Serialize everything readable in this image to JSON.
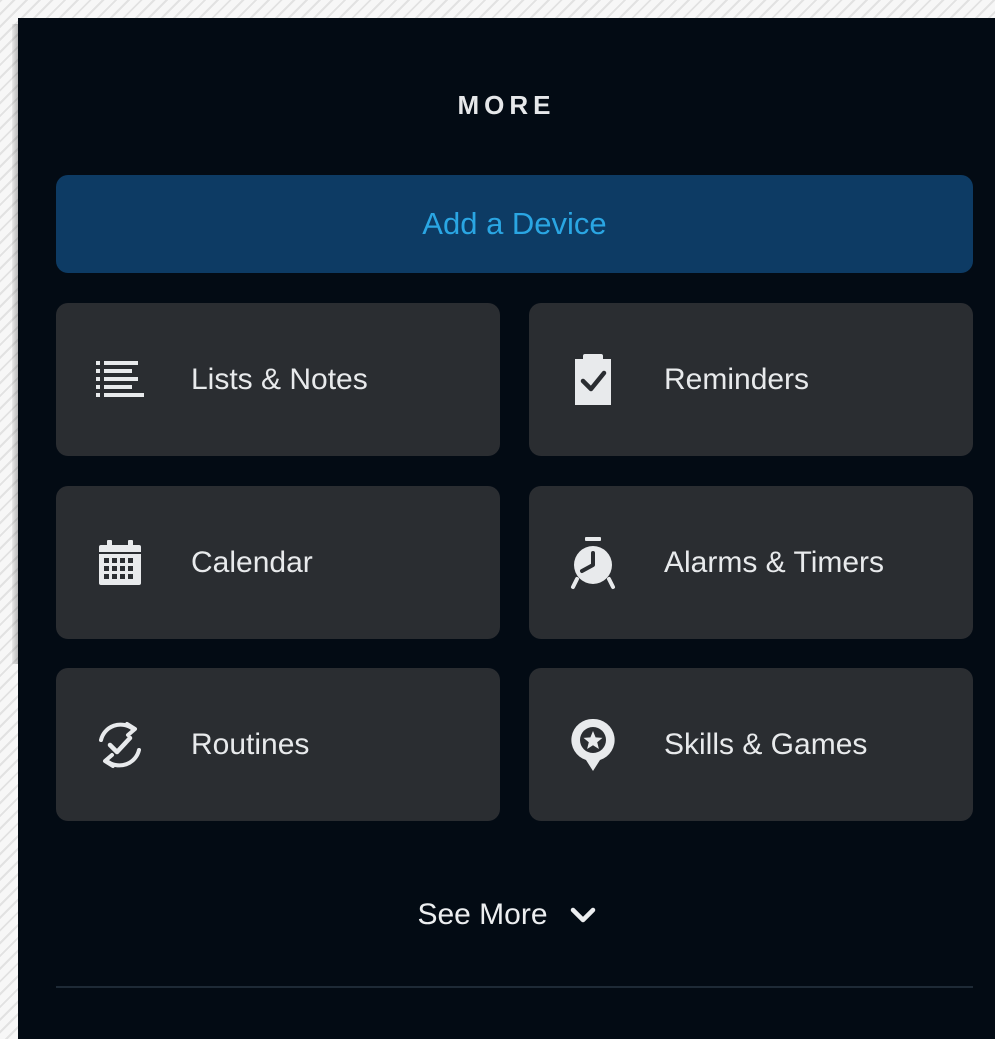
{
  "panel": {
    "title": "MORE",
    "primary_action": {
      "label": "Add a Device"
    },
    "tiles": [
      {
        "label": "Lists & Notes",
        "icon": "list-icon"
      },
      {
        "label": "Reminders",
        "icon": "clipboard-check-icon"
      },
      {
        "label": "Calendar",
        "icon": "calendar-icon"
      },
      {
        "label": "Alarms & Timers",
        "icon": "alarm-clock-icon"
      },
      {
        "label": "Routines",
        "icon": "routine-check-icon"
      },
      {
        "label": "Skills & Games",
        "icon": "skills-star-pin-icon"
      }
    ],
    "see_more": {
      "label": "See More",
      "icon": "chevron-down-icon"
    }
  },
  "colors": {
    "panel_background": "#030b14",
    "tile_background": "#2a2d31",
    "primary_button_background": "#0d3b64",
    "primary_button_text": "#2aa6e3",
    "text": "#e8eaec"
  }
}
